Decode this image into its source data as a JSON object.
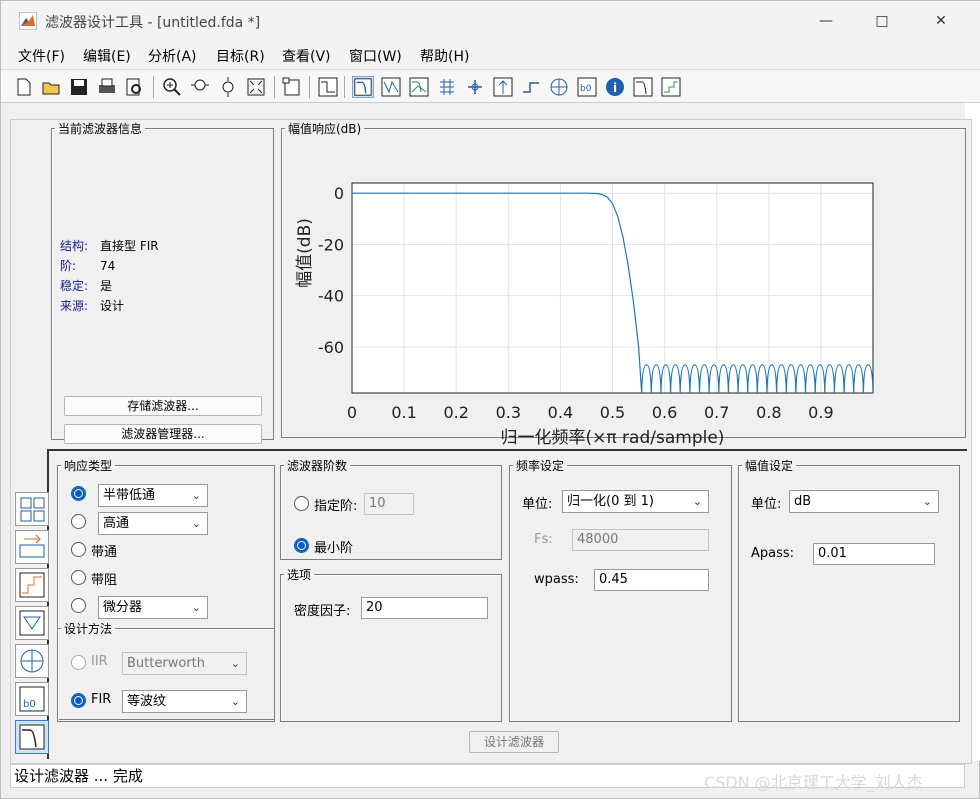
{
  "window": {
    "title": "滤波器设计工具 -  [untitled.fda *]"
  },
  "menu": [
    "文件(F)",
    "编辑(E)",
    "分析(A)",
    "目标(R)",
    "查看(V)",
    "窗口(W)",
    "帮助(H)"
  ],
  "info_panel": {
    "legend": "当前滤波器信息",
    "rows": [
      {
        "key": "结构:",
        "value": "直接型 FIR"
      },
      {
        "key": "阶:",
        "value": "74"
      },
      {
        "key": "稳定:",
        "value": "是"
      },
      {
        "key": "来源:",
        "value": "设计"
      }
    ],
    "store_button": "存储滤波器...",
    "manager_button": "滤波器管理器..."
  },
  "plot_panel": {
    "legend": "幅值响应(dB)"
  },
  "chart_data": {
    "type": "line",
    "title": "",
    "xlabel": "归一化频率(×π rad/sample)",
    "ylabel": "幅值(dB)",
    "xlim": [
      0,
      1
    ],
    "ylim": [
      -78,
      4
    ],
    "x_ticks": [
      "0",
      "0.1",
      "0.2",
      "0.3",
      "0.4",
      "0.5",
      "0.6",
      "0.7",
      "0.8",
      "0.9"
    ],
    "y_ticks": [
      "0",
      "-20",
      "-40",
      "-60"
    ],
    "grid": true,
    "series": [
      {
        "color": "#1f77b4",
        "x": [
          0,
          0.1,
          0.2,
          0.3,
          0.4,
          0.45,
          0.47,
          0.48,
          0.49,
          0.5,
          0.51,
          0.52,
          0.53,
          0.54,
          0.55,
          0.556
        ],
        "y": [
          0,
          0,
          0,
          0,
          0,
          0,
          -0.1,
          -0.5,
          -1.5,
          -4,
          -9,
          -17,
          -28,
          -42,
          -60,
          -78
        ]
      }
    ],
    "stopband": {
      "start": 0.556,
      "end": 1.0,
      "lobe_top": -67,
      "lobe_floor": -78,
      "lobe_count": 24
    }
  },
  "response_type": {
    "legend": "响应类型",
    "options": [
      {
        "label": "半带低通",
        "selected": true,
        "has_dropdown": true
      },
      {
        "label": "高通",
        "selected": false,
        "has_dropdown": true
      },
      {
        "label": "带通",
        "selected": false,
        "has_dropdown": false
      },
      {
        "label": "带阻",
        "selected": false,
        "has_dropdown": false
      },
      {
        "label": "微分器",
        "selected": false,
        "has_dropdown": true
      }
    ]
  },
  "design_method": {
    "legend": "设计方法",
    "iir_label": "IIR",
    "iir_value": "Butterworth",
    "fir_label": "FIR",
    "fir_value": "等波纹"
  },
  "filter_order": {
    "legend": "滤波器阶数",
    "specify_label": "指定阶:",
    "specify_value": "10",
    "minimum_label": "最小阶"
  },
  "options": {
    "legend": "选项",
    "density_label": "密度因子:",
    "density_value": "20"
  },
  "freq_spec": {
    "legend": "频率设定",
    "unit_label": "单位:",
    "unit_value": "归一化(0 到 1)",
    "fs_label": "Fs:",
    "fs_value": "48000",
    "wpass_label": "wpass:",
    "wpass_value": "0.45"
  },
  "mag_spec": {
    "legend": "幅值设定",
    "unit_label": "单位:",
    "unit_value": "dB",
    "apass_label": "Apass:",
    "apass_value": "0.01"
  },
  "design_button": "设计滤波器",
  "status": "设计滤波器 ... 完成",
  "watermark": "CSDN @北京理工大学_刘人杰"
}
